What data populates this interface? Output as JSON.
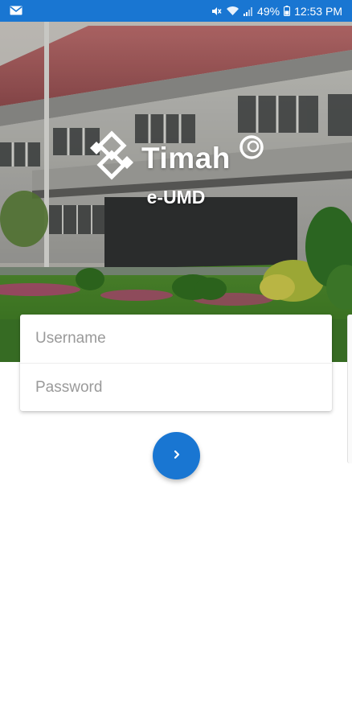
{
  "status_bar": {
    "notification_icon": "mail-icon",
    "battery": "49%",
    "time": "12:53 PM",
    "icons": [
      "mute-icon",
      "wifi-icon",
      "signal-icon",
      "battery-icon"
    ]
  },
  "hero": {
    "brand_name": "Timah",
    "app_title": "e-UMD",
    "logo_icon": "timah-logo-icon"
  },
  "login": {
    "username_placeholder": "Username",
    "password_placeholder": "Password",
    "submit_icon": "chevron-right-icon"
  },
  "colors": {
    "primary": "#1976d2",
    "background": "#ffffff",
    "placeholder": "#9a9a9a"
  }
}
